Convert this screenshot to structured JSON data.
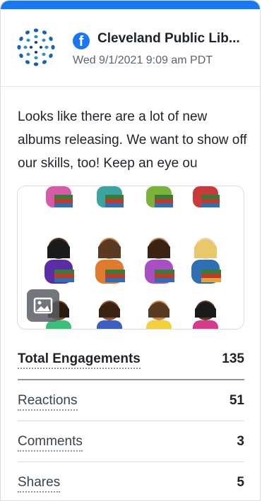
{
  "post": {
    "page_name": "Cleveland Public Lib...",
    "timestamp": "Wed 9/1/2021 9:09 am PDT",
    "text": "Looks like there are a lot of new albums releasing. We want to show off our skills, too! Keep an eye ou",
    "network_icon": "facebook-icon",
    "media_icon": "image-icon"
  },
  "metrics": [
    {
      "label": "Total Engagements",
      "value": "135"
    },
    {
      "label": "Reactions",
      "value": "51"
    },
    {
      "label": "Comments",
      "value": "3"
    },
    {
      "label": "Shares",
      "value": "5"
    }
  ],
  "colors": {
    "accent": "#1877f2",
    "text": "#1d2329",
    "muted": "#5b646e",
    "border": "#d9dde1"
  }
}
